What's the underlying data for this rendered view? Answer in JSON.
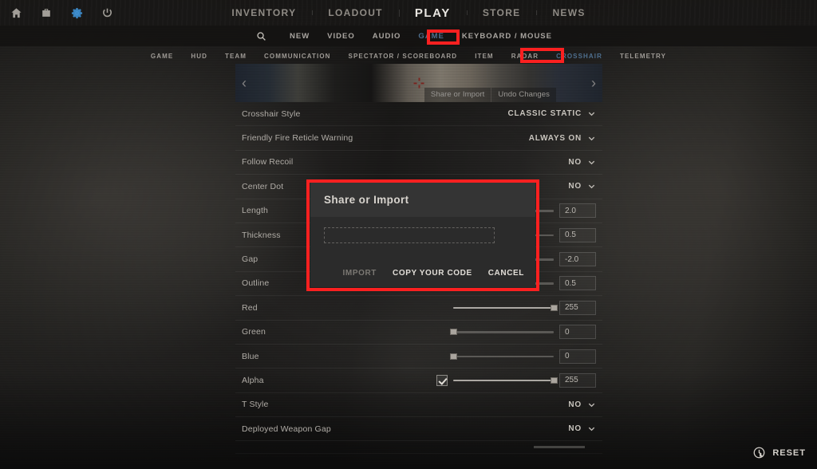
{
  "system_icons": [
    {
      "name": "home-icon",
      "label": "Home",
      "active": false
    },
    {
      "name": "briefcase-icon",
      "label": "Inventory Case",
      "active": false
    },
    {
      "name": "gear-icon",
      "label": "Settings",
      "active": true
    },
    {
      "name": "power-icon",
      "label": "Power",
      "active": false
    }
  ],
  "main_nav": {
    "items": [
      {
        "label": "INVENTORY",
        "active": false
      },
      {
        "label": "LOADOUT",
        "active": false
      },
      {
        "label": "PLAY",
        "active": true
      },
      {
        "label": "STORE",
        "active": false
      },
      {
        "label": "NEWS",
        "active": false
      }
    ]
  },
  "sub_nav": {
    "search_icon": "search-icon",
    "items": [
      {
        "label": "NEW",
        "selected": false
      },
      {
        "label": "VIDEO",
        "selected": false
      },
      {
        "label": "AUDIO",
        "selected": false
      },
      {
        "label": "GAME",
        "selected": true
      },
      {
        "label": "KEYBOARD / MOUSE",
        "selected": false
      }
    ]
  },
  "category_nav": {
    "items": [
      {
        "label": "GAME",
        "selected": false
      },
      {
        "label": "HUD",
        "selected": false
      },
      {
        "label": "TEAM",
        "selected": false
      },
      {
        "label": "COMMUNICATION",
        "selected": false
      },
      {
        "label": "SPECTATOR / SCOREBOARD",
        "selected": false
      },
      {
        "label": "ITEM",
        "selected": false
      },
      {
        "label": "RADAR",
        "selected": false
      },
      {
        "label": "CROSSHAIR",
        "selected": true
      },
      {
        "label": "TELEMETRY",
        "selected": false
      }
    ]
  },
  "preview": {
    "prev_arrow": "‹",
    "next_arrow": "›",
    "share_button": "Share or Import",
    "undo_button": "Undo Changes"
  },
  "settings": {
    "rows": [
      {
        "label": "Crosshair Style",
        "kind": "dropdown",
        "value": "CLASSIC STATIC"
      },
      {
        "label": "Friendly Fire Reticle Warning",
        "kind": "dropdown",
        "value": "ALWAYS ON"
      },
      {
        "label": "Follow Recoil",
        "kind": "dropdown",
        "value": "NO"
      },
      {
        "label": "Center Dot",
        "kind": "dropdown",
        "value": "NO"
      },
      {
        "label": "Length",
        "kind": "slider",
        "value": "2.0",
        "percent": 38
      },
      {
        "label": "Thickness",
        "kind": "slider",
        "value": "0.5",
        "percent": 22
      },
      {
        "label": "Gap",
        "kind": "slider",
        "value": "-2.0",
        "percent": 30
      },
      {
        "label": "Outline",
        "kind": "slider",
        "value": "0.5",
        "percent": 22
      },
      {
        "label": "Red",
        "kind": "slider",
        "value": "255",
        "percent": 100
      },
      {
        "label": "Green",
        "kind": "slider",
        "value": "0",
        "percent": 0
      },
      {
        "label": "Blue",
        "kind": "slider",
        "value": "0",
        "percent": 0
      },
      {
        "label": "Alpha",
        "kind": "slider-check",
        "value": "255",
        "percent": 100,
        "checked": true
      },
      {
        "label": "T Style",
        "kind": "dropdown",
        "value": "NO"
      },
      {
        "label": "Deployed Weapon Gap",
        "kind": "dropdown",
        "value": "NO"
      }
    ]
  },
  "dialog": {
    "title": "Share or Import",
    "input_value": "",
    "input_placeholder": "",
    "import_label": "IMPORT",
    "copy_label": "COPY YOUR CODE",
    "cancel_label": "CANCEL"
  },
  "reset": {
    "icon": "history-clock-icon",
    "label": "RESET"
  },
  "colors": {
    "annotation": "#fb2020",
    "selected_tab": "#4e6f8e",
    "accent_icon": "#3d8fd1",
    "dialog_bg": "#2b2b2b",
    "dialog_header_bg": "#343434"
  }
}
